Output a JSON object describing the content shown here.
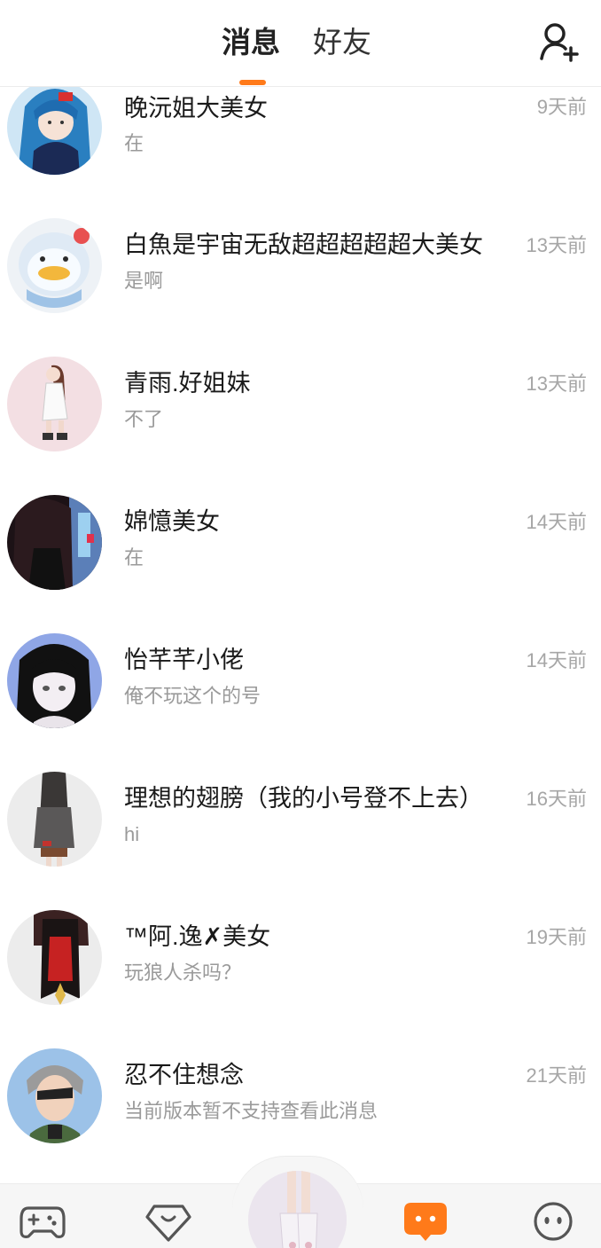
{
  "header": {
    "tab_messages": "消息",
    "tab_friends": "好友",
    "add_friend_icon": "add-person-icon",
    "accent_color": "#ff7a1a"
  },
  "conversations": [
    {
      "name": "晚沅姐大美女",
      "preview": "在",
      "time": "9天前"
    },
    {
      "name": "白魚是宇宙无敌超超超超超大美女",
      "preview": "是啊",
      "time": "13天前"
    },
    {
      "name": "青雨.好姐妹",
      "preview": "不了",
      "time": "13天前"
    },
    {
      "name": "婂憶美女",
      "preview": "在",
      "time": "14天前"
    },
    {
      "name": "怡芊芊小佬",
      "preview": "俺不玩这个的号",
      "time": "14天前"
    },
    {
      "name": "理想的翅膀（我的小号登不上去）",
      "preview": "hi",
      "time": "16天前"
    },
    {
      "name": "™阿.逸✗美女",
      "preview": "玩狼人杀吗？",
      "time": "19天前"
    },
    {
      "name": "忍不住想念",
      "preview": "当前版本暂不支持查看此消息",
      "time": "21天前"
    }
  ],
  "bottom_nav": {
    "items": [
      "gamepad-icon",
      "heart-badge-icon",
      "avatar-center",
      "chat-bubble-icon",
      "smiley-icon"
    ],
    "active": "chat-bubble-icon",
    "active_color": "#ff7a1a",
    "inactive_color": "#555555"
  }
}
